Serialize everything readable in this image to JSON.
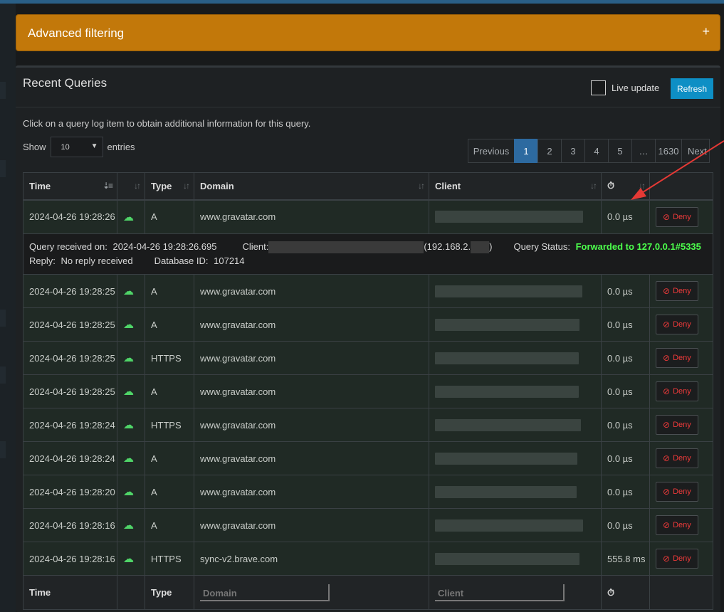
{
  "advanced": {
    "title": "Advanced filtering",
    "toggle": "+"
  },
  "box": {
    "title": "Recent Queries",
    "live_update_label": "Live update",
    "refresh_label": "Refresh",
    "hint": "Click on a query log item to obtain additional information for this query.",
    "show_label": "Show",
    "show_value": "10",
    "entries_label": "entries"
  },
  "pagination": [
    "Previous",
    "1",
    "2",
    "3",
    "4",
    "5",
    "…",
    "1630",
    "Next"
  ],
  "active_page": "1",
  "columns": {
    "time": "Time",
    "type": "Type",
    "domain": "Domain",
    "client": "Client"
  },
  "footer": {
    "time": "Time",
    "type": "Type",
    "domain_placeholder": "Domain",
    "client_placeholder": "Client"
  },
  "deny_label": "Deny",
  "rows": [
    {
      "time": "2024-04-26 19:28:26",
      "type": "A",
      "domain": "www.gravatar.com",
      "reply": "0.0 µs"
    },
    {
      "time": "2024-04-26 19:28:25",
      "type": "A",
      "domain": "www.gravatar.com",
      "reply": "0.0 µs"
    },
    {
      "time": "2024-04-26 19:28:25",
      "type": "A",
      "domain": "www.gravatar.com",
      "reply": "0.0 µs"
    },
    {
      "time": "2024-04-26 19:28:25",
      "type": "HTTPS",
      "domain": "www.gravatar.com",
      "reply": "0.0 µs"
    },
    {
      "time": "2024-04-26 19:28:25",
      "type": "A",
      "domain": "www.gravatar.com",
      "reply": "0.0 µs"
    },
    {
      "time": "2024-04-26 19:28:24",
      "type": "HTTPS",
      "domain": "www.gravatar.com",
      "reply": "0.0 µs"
    },
    {
      "time": "2024-04-26 19:28:24",
      "type": "A",
      "domain": "www.gravatar.com",
      "reply": "0.0 µs"
    },
    {
      "time": "2024-04-26 19:28:20",
      "type": "A",
      "domain": "www.gravatar.com",
      "reply": "0.0 µs"
    },
    {
      "time": "2024-04-26 19:28:16",
      "type": "A",
      "domain": "www.gravatar.com",
      "reply": "0.0 µs"
    },
    {
      "time": "2024-04-26 19:28:16",
      "type": "HTTPS",
      "domain": "sync-v2.brave.com",
      "reply": "555.8 ms"
    }
  ],
  "detail": {
    "received_label": "Query received on:",
    "received_value": "2024-04-26 19:28:26.695",
    "client_label": "Client:",
    "client_ip": "(192.168.2.",
    "client_ip_end": ")",
    "status_label": "Query Status:",
    "status_value": "Forwarded to 127.0.0.1#5335",
    "reply_label": "Reply:",
    "reply_value": "No reply received",
    "dbid_label": "Database ID:",
    "dbid_value": "107214"
  },
  "colors": {
    "accent": "#c2780a",
    "refresh": "#0e8fc5",
    "status_ok": "#4cff4c",
    "deny": "#ef3a3a",
    "arrow": "#e53935"
  }
}
